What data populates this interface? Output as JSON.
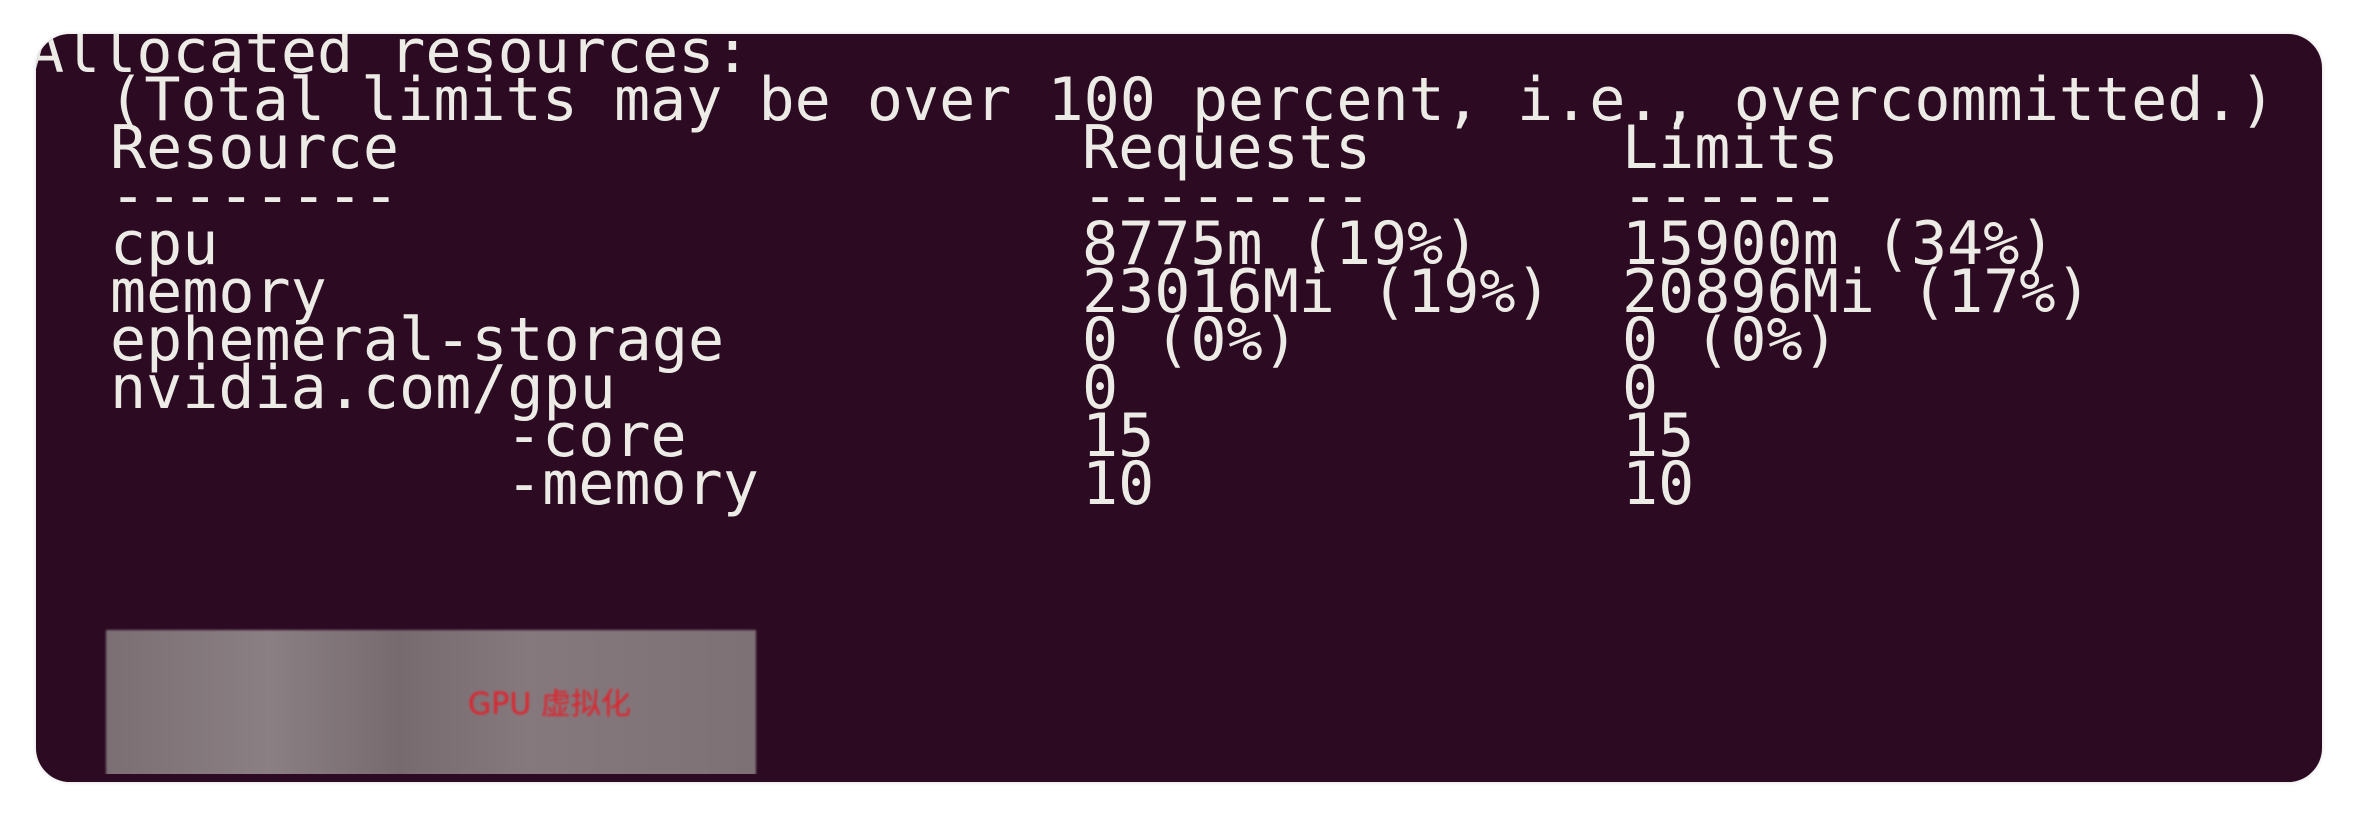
{
  "terminal": {
    "header": "Allocated resources:",
    "note": "  (Total limits may be over 100 percent, i.e., overcommitted.)",
    "columns": {
      "resource": "Resource",
      "requests": "Requests",
      "limits": "Limits"
    },
    "separators": {
      "resource": "--------",
      "requests": "--------",
      "limits": "------"
    },
    "rows": [
      {
        "resource": "cpu",
        "requests": "8775m (19%)",
        "limits": "15900m (34%)"
      },
      {
        "resource": "memory",
        "requests": "23016Mi (19%)",
        "limits": "20896Mi (17%)"
      },
      {
        "resource": "ephemeral-storage",
        "requests": "0 (0%)",
        "limits": "0 (0%)"
      },
      {
        "resource": "nvidia.com/gpu",
        "requests": "0",
        "limits": "0"
      },
      {
        "resource": "-core",
        "requests": "15",
        "limits": "15"
      },
      {
        "resource": "-memory",
        "requests": "10",
        "limits": "10"
      }
    ]
  },
  "redaction": {
    "label": "GPU 虚拟化"
  },
  "colors": {
    "background": "#2c0a22",
    "text": "#ecebe6",
    "redaction_label": "#e3202a"
  }
}
